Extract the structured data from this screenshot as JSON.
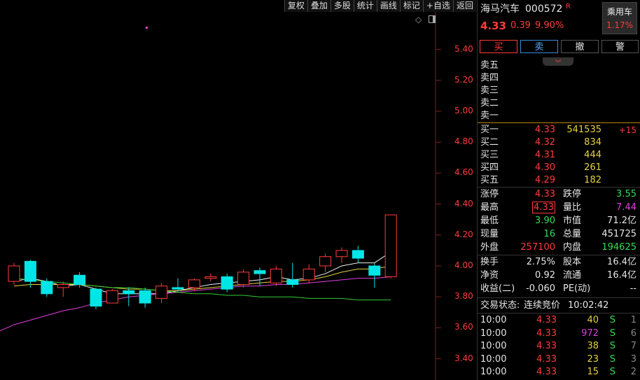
{
  "toolbar": [
    "复权",
    "叠加",
    "多股",
    "统计",
    "画线",
    "标记",
    "+自选",
    "返回"
  ],
  "price_axis": [
    "5.40",
    "5.20",
    "5.00",
    "4.80",
    "4.60",
    "4.40",
    "4.20",
    "4.00",
    "3.80",
    "3.60",
    "3.40"
  ],
  "stock": {
    "name": "海马汽车",
    "code": "000572",
    "flag": "R",
    "price": "4.33",
    "change": "0.39",
    "pct": "9.90%",
    "sector": "乘用车",
    "sector_pct": "1.17%"
  },
  "actions": {
    "buy": "买",
    "sell": "卖",
    "cancel": "撤",
    "alert": "警"
  },
  "asks": [
    "卖五",
    "卖四",
    "卖三",
    "卖二",
    "卖一"
  ],
  "bids": [
    {
      "label": "买一",
      "price": "4.33",
      "vol": "541535",
      "delta": "+15"
    },
    {
      "label": "买二",
      "price": "4.32",
      "vol": "834",
      "delta": ""
    },
    {
      "label": "买三",
      "price": "4.31",
      "vol": "444",
      "delta": ""
    },
    {
      "label": "买四",
      "price": "4.30",
      "vol": "261",
      "delta": ""
    },
    {
      "label": "买五",
      "price": "4.29",
      "vol": "182",
      "delta": ""
    }
  ],
  "stats": [
    {
      "l1": "涨停",
      "v1": "4.33",
      "c1": "red",
      "l2": "跌停",
      "v2": "3.55",
      "c2": "green"
    },
    {
      "l1": "最高",
      "v1": "4.33",
      "c1": "red",
      "l2": "量比",
      "v2": "7.44",
      "c2": "magenta"
    },
    {
      "l1": "最低",
      "v1": "3.90",
      "c1": "green",
      "l2": "市值",
      "v2": "71.2亿",
      "c2": "white"
    },
    {
      "l1": "现量",
      "v1": "16",
      "c1": "green",
      "l2": "总量",
      "v2": "451725",
      "c2": "white"
    },
    {
      "l1": "外盘",
      "v1": "257100",
      "c1": "red",
      "l2": "内盘",
      "v2": "194625",
      "c2": "green"
    }
  ],
  "stats2": [
    {
      "l1": "换手",
      "v1": "2.75%",
      "l2": "股本",
      "v2": "16.4亿"
    },
    {
      "l1": "净资",
      "v1": "0.92",
      "l2": "流通",
      "v2": "16.4亿"
    },
    {
      "l1": "收益(二)",
      "v1": "-0.060",
      "l2": "PE(动)",
      "v2": "--"
    }
  ],
  "status": {
    "label": "交易状态:",
    "value": "连续竞价",
    "time": "10:02:42"
  },
  "ticks": [
    {
      "time": "10:00",
      "price": "4.33",
      "vol": "40",
      "side": "S",
      "n": "1",
      "vc": "yellow"
    },
    {
      "time": "10:00",
      "price": "4.33",
      "vol": "972",
      "side": "S",
      "n": "6",
      "vc": "magenta"
    },
    {
      "time": "10:00",
      "price": "4.33",
      "vol": "38",
      "side": "S",
      "n": "7",
      "vc": "yellow"
    },
    {
      "time": "10:00",
      "price": "4.33",
      "vol": "23",
      "side": "S",
      "n": "3",
      "vc": "yellow"
    },
    {
      "time": "10:00",
      "price": "4.33",
      "vol": "15",
      "side": "S",
      "n": "2",
      "vc": "yellow"
    }
  ],
  "candles": [
    {
      "o": 3.9,
      "c": 4.0,
      "h": 4.02,
      "l": 3.88
    },
    {
      "o": 4.03,
      "c": 3.9,
      "h": 4.04,
      "l": 3.86
    },
    {
      "o": 3.9,
      "c": 3.82,
      "h": 3.92,
      "l": 3.8
    },
    {
      "o": 3.86,
      "c": 3.88,
      "h": 3.9,
      "l": 3.8
    },
    {
      "o": 3.94,
      "c": 3.88,
      "h": 3.96,
      "l": 3.86
    },
    {
      "o": 3.85,
      "c": 3.74,
      "h": 3.86,
      "l": 3.72
    },
    {
      "o": 3.76,
      "c": 3.84,
      "h": 3.85,
      "l": 3.76
    },
    {
      "o": 3.84,
      "c": 3.82,
      "h": 3.86,
      "l": 3.74
    },
    {
      "o": 3.84,
      "c": 3.76,
      "h": 3.86,
      "l": 3.73
    },
    {
      "o": 3.79,
      "c": 3.87,
      "h": 3.89,
      "l": 3.76
    },
    {
      "o": 3.86,
      "c": 3.85,
      "h": 3.92,
      "l": 3.83
    },
    {
      "o": 3.86,
      "c": 3.91,
      "h": 3.92,
      "l": 3.84
    },
    {
      "o": 3.92,
      "c": 3.93,
      "h": 3.95,
      "l": 3.9
    },
    {
      "o": 3.93,
      "c": 3.85,
      "h": 3.95,
      "l": 3.83
    },
    {
      "o": 3.88,
      "c": 3.96,
      "h": 3.98,
      "l": 3.86
    },
    {
      "o": 3.97,
      "c": 3.95,
      "h": 3.99,
      "l": 3.87
    },
    {
      "o": 3.89,
      "c": 3.98,
      "h": 4.0,
      "l": 3.87
    },
    {
      "o": 3.91,
      "c": 3.88,
      "h": 4.02,
      "l": 3.86
    },
    {
      "o": 3.91,
      "c": 3.98,
      "h": 4.01,
      "l": 3.89
    },
    {
      "o": 4.0,
      "c": 4.06,
      "h": 4.08,
      "l": 3.96
    },
    {
      "o": 4.06,
      "c": 4.1,
      "h": 4.12,
      "l": 4.02
    },
    {
      "o": 4.1,
      "c": 4.05,
      "h": 4.13,
      "l": 4.02
    },
    {
      "o": 4.0,
      "c": 3.94,
      "h": 4.02,
      "l": 3.86
    },
    {
      "o": 3.93,
      "c": 4.33,
      "h": 4.33,
      "l": 3.92
    }
  ],
  "ma": [
    {
      "color": "#f0f0f0",
      "values": [
        3.9,
        3.92,
        3.9,
        3.87,
        3.88,
        3.85,
        3.82,
        3.82,
        3.82,
        3.82,
        3.84,
        3.86,
        3.88,
        3.89,
        3.9,
        3.91,
        3.93,
        3.91,
        3.92,
        3.95,
        4.0,
        4.02,
        4.02,
        4.09
      ]
    },
    {
      "color": "#e6d23c",
      "values": [
        3.87,
        3.88,
        3.88,
        3.88,
        3.88,
        3.87,
        3.86,
        3.85,
        3.85,
        3.84,
        3.84,
        3.85,
        3.86,
        3.87,
        3.88,
        3.89,
        3.9,
        3.9,
        3.91,
        3.93,
        3.96,
        3.98,
        3.98,
        4.0
      ]
    },
    {
      "color": "#e040e0",
      "values": [
        3.62,
        3.65,
        3.68,
        3.71,
        3.73,
        3.76,
        3.78,
        3.8,
        3.81,
        3.82,
        3.83,
        3.84,
        3.85,
        3.86,
        3.87,
        3.87,
        3.88,
        3.88,
        3.89,
        3.9,
        3.91,
        3.92,
        3.92,
        3.93
      ]
    },
    {
      "color": "#33cc33",
      "values": [
        3.92,
        3.91,
        3.9,
        3.89,
        3.88,
        3.87,
        3.86,
        3.86,
        3.85,
        3.84,
        3.83,
        3.82,
        3.82,
        3.81,
        3.81,
        3.8,
        3.8,
        3.8,
        3.79,
        3.79,
        3.79,
        3.78,
        3.78,
        3.78
      ]
    }
  ]
}
